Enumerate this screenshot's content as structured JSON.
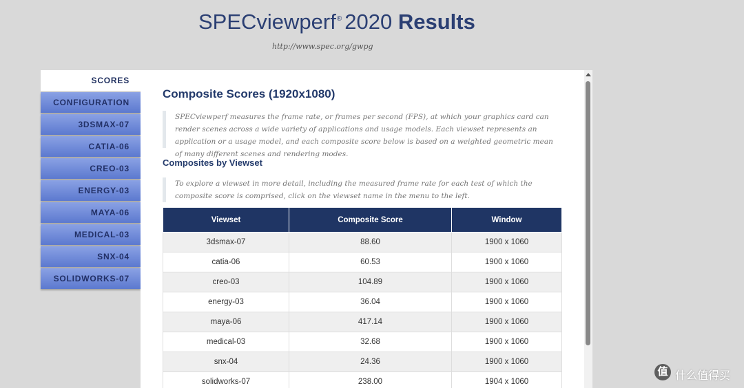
{
  "header": {
    "title_main": "SPECviewperf",
    "title_reg": "®",
    "title_year": "2020",
    "title_bold": "Results",
    "url": "http://www.spec.org/gwpg"
  },
  "sidebar": {
    "items": [
      {
        "label": "SCORES",
        "active": true
      },
      {
        "label": "CONFIGURATION",
        "active": false
      },
      {
        "label": "3DSMAX-07",
        "active": false
      },
      {
        "label": "CATIA-06",
        "active": false
      },
      {
        "label": "CREO-03",
        "active": false
      },
      {
        "label": "ENERGY-03",
        "active": false
      },
      {
        "label": "MAYA-06",
        "active": false
      },
      {
        "label": "MEDICAL-03",
        "active": false
      },
      {
        "label": "SNX-04",
        "active": false
      },
      {
        "label": "SOLIDWORKS-07",
        "active": false
      }
    ]
  },
  "main": {
    "title": "Composite Scores (1920x1080)",
    "intro": "SPECviewperf measures the frame rate, or frames per second (FPS), at which your graphics card can render scenes across a wide variety of applications and usage models. Each viewset represents an application or a usage model, and each composite score below is based on a weighted geometric mean of many different scenes and rendering modes.",
    "subtitle": "Composites by Viewset",
    "explore_note": "To explore a viewset in more detail, including the measured frame rate for each test of which the composite score is comprised, click on the viewset name in the menu to the left.",
    "table": {
      "headers": [
        "Viewset",
        "Composite Score",
        "Window"
      ],
      "rows": [
        [
          "3dsmax-07",
          "88.60",
          "1900 x 1060"
        ],
        [
          "catia-06",
          "60.53",
          "1900 x 1060"
        ],
        [
          "creo-03",
          "104.89",
          "1900 x 1060"
        ],
        [
          "energy-03",
          "36.04",
          "1900 x 1060"
        ],
        [
          "maya-06",
          "417.14",
          "1900 x 1060"
        ],
        [
          "medical-03",
          "32.68",
          "1900 x 1060"
        ],
        [
          "snx-04",
          "24.36",
          "1900 x 1060"
        ],
        [
          "solidworks-07",
          "238.00",
          "1904 x 1060"
        ]
      ]
    }
  },
  "watermark": {
    "icon": "值",
    "text": "什么值得买"
  },
  "colors": {
    "table_header_bg": "#1f3564",
    "sidebar_gradient_top": "#8aa1e4",
    "sidebar_gradient_bottom": "#5c79cf",
    "title_color": "#2b3f73"
  }
}
